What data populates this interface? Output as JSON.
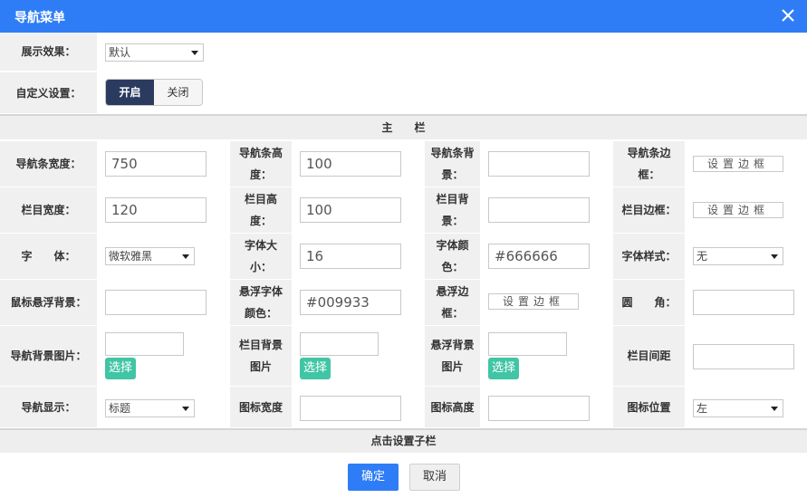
{
  "dialog": {
    "title": "导航菜单"
  },
  "display": {
    "label": "展示效果：",
    "select_value": "默认"
  },
  "custom": {
    "label": "自定义设置：",
    "on_label": "开启",
    "off_label": "关闭"
  },
  "main_section": {
    "header": "主　　栏"
  },
  "rows": {
    "r1": {
      "nav_width_label": "导航条宽度：",
      "nav_width_value": "750",
      "nav_height_label1": "导航条高",
      "nav_height_label2": "度：",
      "nav_height_value": "100",
      "nav_bg_label1": "导航条背",
      "nav_bg_label2": "景：",
      "nav_bg_value": "",
      "nav_border_label1": "导航条边",
      "nav_border_label2": "框：",
      "nav_border_button": "设置边框"
    },
    "r2": {
      "col_width_label": "栏目宽度：",
      "col_width_value": "120",
      "col_height_label1": "栏目高",
      "col_height_label2": "度：",
      "col_height_value": "100",
      "col_bg_label1": "栏目背",
      "col_bg_label2": "景：",
      "col_bg_value": "",
      "col_border_label": "栏目边框：",
      "col_border_button": "设置边框"
    },
    "r3": {
      "font_label": "字　　体：",
      "font_select": "微软雅黑",
      "font_size_label1": "字体大",
      "font_size_label2": "小：",
      "font_size_value": "16",
      "font_color_label1": "字体颜",
      "font_color_label2": "色：",
      "font_color_value": "#666666",
      "font_style_label": "字体样式：",
      "font_style_select": "无"
    },
    "r4": {
      "hover_bg_label": "鼠标悬浮背景：",
      "hover_bg_value": "",
      "hover_font_color_label1": "悬浮字体",
      "hover_font_color_label2": "颜色：",
      "hover_font_color_value": "#009933",
      "hover_border_label1": "悬浮边",
      "hover_border_label2": "框：",
      "hover_border_button": "设置边框",
      "radius_label": "圆　　角：",
      "radius_value": ""
    },
    "r5": {
      "nav_bg_img_label": "导航背景图片：",
      "nav_bg_img_button": "选择",
      "col_bg_img_label1": "栏目背景",
      "col_bg_img_label2": "图片",
      "col_bg_img_button": "选择",
      "hover_bg_img_label1": "悬浮背景",
      "hover_bg_img_label2": "图片",
      "hover_bg_img_button": "选择",
      "col_spacing_label": "栏目间距",
      "col_spacing_value": ""
    },
    "r6": {
      "nav_display_label": "导航显示：",
      "nav_display_select": "标题",
      "icon_width_label": "图标宽度",
      "icon_width_value": "",
      "icon_height_label": "图标高度",
      "icon_height_value": "",
      "icon_pos_label": "图标位置",
      "icon_pos_select": "左"
    }
  },
  "sub_section": {
    "header": "点击设置子栏"
  },
  "footer": {
    "ok_label": "确定",
    "cancel_label": "取消"
  },
  "colors": {
    "titlebar": "#2f7df6",
    "toggle_on": "#2b3a5f",
    "choose_button": "#41c5a4",
    "ok_button": "#2f7df6"
  }
}
